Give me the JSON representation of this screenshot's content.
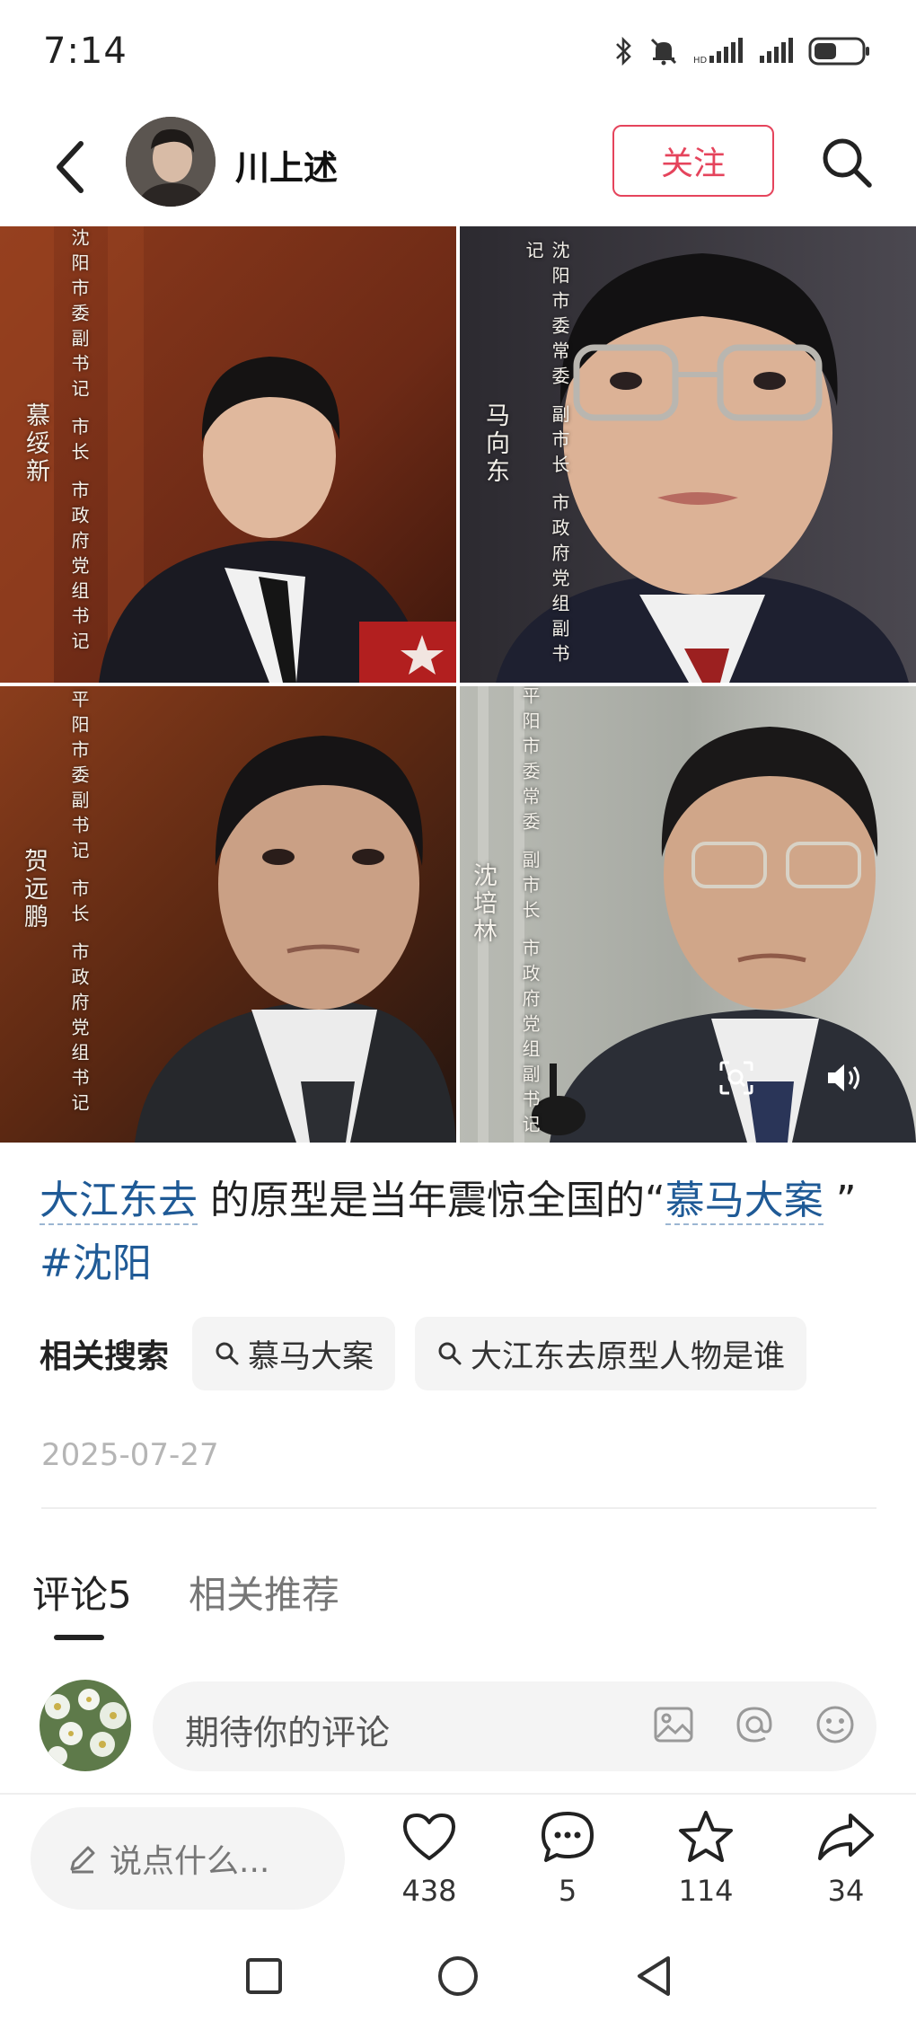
{
  "status_bar": {
    "time": "7:14"
  },
  "header": {
    "author_name": "川上述",
    "follow_label": "关注"
  },
  "images": [
    {
      "name": "慕绥新",
      "title": "沈阳市委副书记 市长 市政府党组书记"
    },
    {
      "name": "马向东",
      "title": "沈阳市委常委 副市长 市政府党组副书记"
    },
    {
      "name": "贺远鹏",
      "title": "平阳市委副书记 市长 市政府党组书记"
    },
    {
      "name": "沈培林",
      "title": "平阳市委常委 副市长 市政府党组副书记"
    }
  ],
  "caption": {
    "link1": "大江东去",
    "middle": " 的原型是当年震惊全国的“",
    "link2": "慕马大案",
    "end": " ”",
    "tag": "#沈阳"
  },
  "related": {
    "label": "相关搜索",
    "chips": [
      "慕马大案",
      "大江东去原型人物是谁"
    ]
  },
  "date": "2025-07-27",
  "tabs": {
    "comments": "评论5",
    "related": "相关推荐"
  },
  "comment_input": {
    "placeholder": "期待你的评论"
  },
  "action_bar": {
    "say_placeholder": "说点什么...",
    "likes": "438",
    "comments": "5",
    "favorites": "114",
    "shares": "34"
  },
  "colors": {
    "accent": "#e5445c",
    "link": "#1f5a96"
  }
}
